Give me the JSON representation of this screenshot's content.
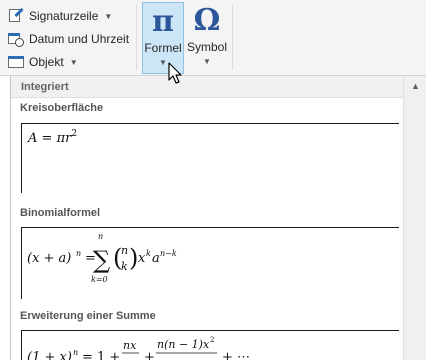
{
  "ribbon": {
    "signature_label": "Signaturzeile",
    "datetime_label": "Datum und Uhrzeit",
    "object_label": "Objekt",
    "formula_glyph": "π",
    "formula_label": "Formel",
    "symbol_glyph": "Ω",
    "symbol_label": "Symbol"
  },
  "gallery": {
    "section_header": "Integriert",
    "items": [
      {
        "title": "Kreisoberfläche"
      },
      {
        "title": "Binomialformel"
      },
      {
        "title": "Erweiterung einer Summe"
      }
    ]
  },
  "colors": {
    "accent_blue": "#2b579a",
    "pressed_button_bg": "#cde6f7",
    "ribbon_bg": "#f4f4f4"
  },
  "icons": [
    "signature-line-icon",
    "date-time-icon",
    "object-icon",
    "pi-icon",
    "omega-icon",
    "scroll-up-arrow-icon",
    "mouse-pointer-icon"
  ]
}
